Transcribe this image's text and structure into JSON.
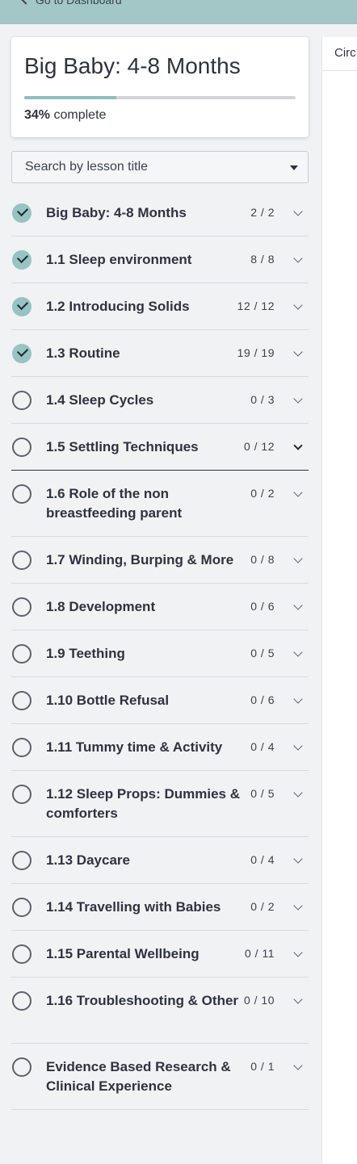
{
  "header": {
    "back_label": "Go to Dashboard"
  },
  "course": {
    "title": "Big Baby: 4-8 Months",
    "percent": "34%",
    "percent_value": 0.34,
    "complete_label": "complete"
  },
  "search": {
    "placeholder": "Search by lesson title"
  },
  "right_panel": {
    "tab_label": "Circ"
  },
  "lessons": [
    {
      "label": "Big Baby: 4-8 Months",
      "count": "2 / 2",
      "done": true
    },
    {
      "label": "1.1 Sleep environment",
      "count": "8 / 8",
      "done": true
    },
    {
      "label": "1.2 Introducing Solids",
      "count": "12 / 12",
      "done": true
    },
    {
      "label": "1.3 Routine",
      "count": "19 / 19",
      "done": true
    },
    {
      "label": "1.4 Sleep Cycles",
      "count": "0 / 3",
      "done": false
    },
    {
      "label": "1.5 Settling Techniques",
      "count": "0 / 12",
      "done": false
    },
    {
      "label": "1.6 Role of the non breastfeeding parent",
      "count": "0 / 2",
      "done": false
    },
    {
      "label": "1.7 Winding, Burping & More",
      "count": "0 / 8",
      "done": false
    },
    {
      "label": "1.8 Development",
      "count": "0 / 6",
      "done": false
    },
    {
      "label": "1.9 Teething",
      "count": "0 / 5",
      "done": false
    },
    {
      "label": "1.10 Bottle Refusal",
      "count": "0 / 6",
      "done": false
    },
    {
      "label": "1.11 Tummy time & Activity",
      "count": "0 / 4",
      "done": false
    },
    {
      "label": "1.12 Sleep Props: Dummies & comforters",
      "count": "0 / 5",
      "done": false
    },
    {
      "label": "1.13 Daycare",
      "count": "0 / 4",
      "done": false
    },
    {
      "label": "1.14 Travelling with Babies",
      "count": "0 / 2",
      "done": false
    },
    {
      "label": "1.15 Parental Wellbeing",
      "count": "0 / 11",
      "done": false
    },
    {
      "label": "1.16 Troubleshooting & Other",
      "count": "0 / 10",
      "done": false
    },
    {
      "label": "Evidence Based Research & Clinical Experience",
      "count": "0 / 1",
      "done": false
    }
  ]
}
